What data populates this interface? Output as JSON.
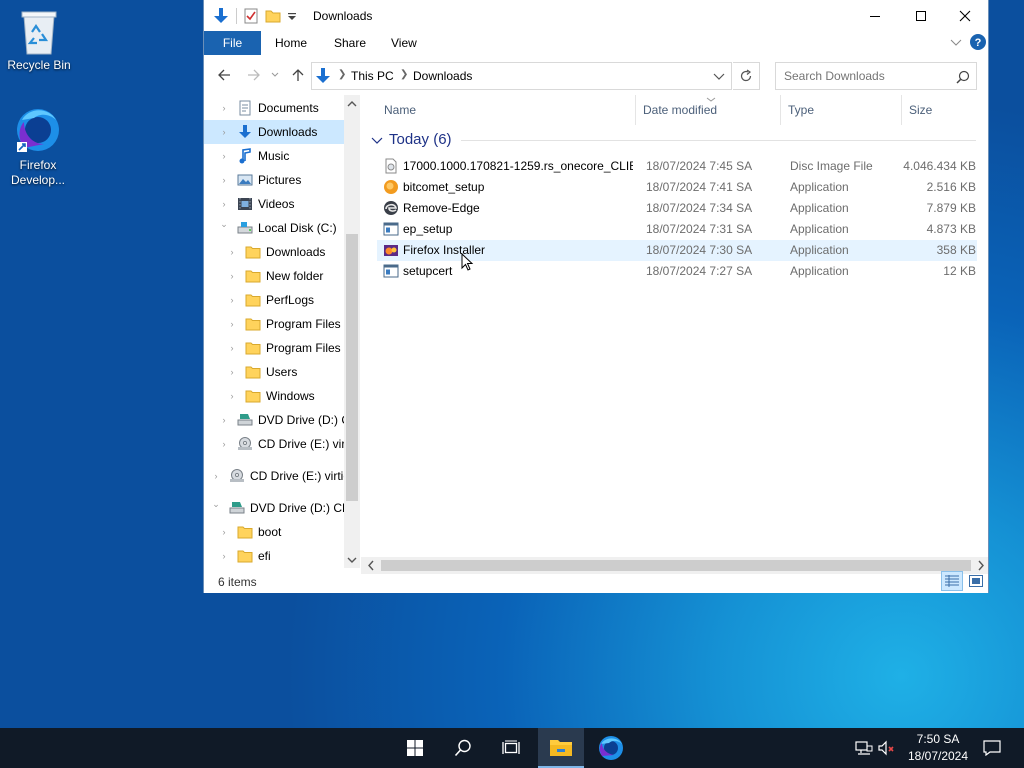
{
  "desktop": {
    "icons": [
      {
        "label": "Recycle Bin"
      },
      {
        "label": "Firefox Develop..."
      }
    ]
  },
  "window": {
    "title": "Downloads",
    "ribbon_tabs": [
      "File",
      "Home",
      "Share",
      "View"
    ],
    "address": {
      "segments": [
        "This PC",
        "Downloads"
      ]
    },
    "search": {
      "placeholder": "Search Downloads"
    },
    "nav_items": [
      {
        "label": "Documents",
        "icon": "documents-icon"
      },
      {
        "label": "Downloads",
        "icon": "downloads-icon",
        "selected": true
      },
      {
        "label": "Music",
        "icon": "music-icon"
      },
      {
        "label": "Pictures",
        "icon": "pictures-icon"
      },
      {
        "label": "Videos",
        "icon": "videos-icon"
      },
      {
        "label": "Local Disk (C:)",
        "icon": "drive-icon",
        "expanded": true
      },
      {
        "label": "Downloads",
        "icon": "folder-icon"
      },
      {
        "label": "New folder",
        "icon": "folder-icon"
      },
      {
        "label": "PerfLogs",
        "icon": "folder-icon"
      },
      {
        "label": "Program Files",
        "icon": "folder-icon"
      },
      {
        "label": "Program Files (",
        "icon": "folder-icon"
      },
      {
        "label": "Users",
        "icon": "folder-icon"
      },
      {
        "label": "Windows",
        "icon": "folder-icon"
      },
      {
        "label": "DVD Drive (D:) C",
        "icon": "dvd-drive-icon"
      },
      {
        "label": "CD Drive (E:) virt",
        "icon": "cd-drive-icon"
      },
      {
        "label": "CD Drive (E:) virtic",
        "icon": "cd-drive-icon"
      },
      {
        "label": "DVD Drive (D:) CEI",
        "icon": "dvd-drive-icon",
        "expanded": true
      },
      {
        "label": "boot",
        "icon": "folder-icon"
      },
      {
        "label": "efi",
        "icon": "folder-icon"
      }
    ],
    "columns": [
      "Name",
      "Date modified",
      "Type",
      "Size"
    ],
    "group": "Today (6)",
    "files": [
      {
        "name": "17000.1000.170821-1259.rs_onecore_CLIE...",
        "date": "18/07/2024 7:45 SA",
        "type": "Disc Image File",
        "size": "4.046.434 KB",
        "icon": "disc-image-icon"
      },
      {
        "name": "bitcomet_setup",
        "date": "18/07/2024 7:41 SA",
        "type": "Application",
        "size": "2.516 KB",
        "icon": "bitcomet-icon"
      },
      {
        "name": "Remove-Edge",
        "date": "18/07/2024 7:34 SA",
        "type": "Application",
        "size": "7.879 KB",
        "icon": "edge-icon"
      },
      {
        "name": "ep_setup",
        "date": "18/07/2024 7:31 SA",
        "type": "Application",
        "size": "4.873 KB",
        "icon": "app-window-icon"
      },
      {
        "name": "Firefox Installer",
        "date": "18/07/2024 7:30 SA",
        "type": "Application",
        "size": "358 KB",
        "icon": "firefox-installer-icon",
        "hover": true
      },
      {
        "name": "setupcert",
        "date": "18/07/2024 7:27 SA",
        "type": "Application",
        "size": "12 KB",
        "icon": "app-window-icon"
      }
    ],
    "status": "6 items"
  },
  "taskbar": {
    "items": [
      "start-icon",
      "search-icon",
      "task-view-icon",
      "file-explorer-icon",
      "firefox-dev-icon"
    ],
    "clock": {
      "time": "7:50 SA",
      "date": "18/07/2024"
    }
  },
  "colors": {
    "accent": "#1a63b0",
    "selection": "#cce8ff",
    "hover": "#e5f3ff",
    "group_header": "#1e3287",
    "taskbar": "#101a27"
  }
}
